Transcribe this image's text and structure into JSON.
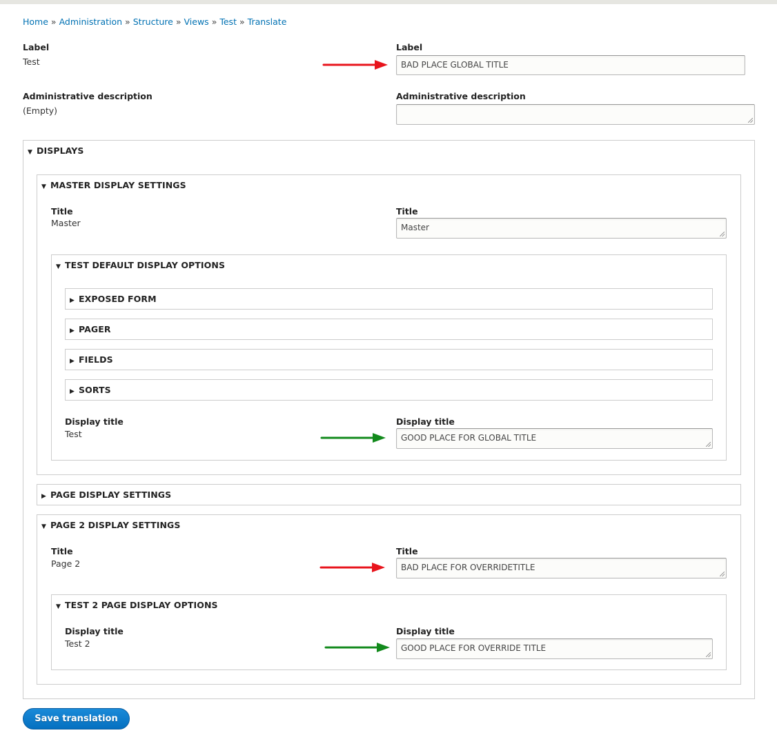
{
  "breadcrumb": [
    "Home",
    "Administration",
    "Structure",
    "Views",
    "Test",
    "Translate"
  ],
  "breadcrumb_sep": "»",
  "label": {
    "left_label": "Label",
    "left_value": "Test",
    "right_label": "Label",
    "input_value": "BAD PLACE GLOBAL TITLE"
  },
  "admin_desc": {
    "left_label": "Administrative description",
    "left_value": "(Empty)",
    "right_label": "Administrative description",
    "input_value": ""
  },
  "displays": {
    "summary": "Displays",
    "master": {
      "summary": "Master display settings",
      "title_label": "Title",
      "title_value": "Master",
      "title_right_label": "Title",
      "title_input": "Master",
      "options": {
        "summary": "Test default display options",
        "collapsed": [
          "Exposed form",
          "Pager",
          "Fields",
          "Sorts"
        ],
        "display_title_label": "Display title",
        "display_title_value": "Test",
        "display_title_right_label": "Display title",
        "display_title_input": "GOOD PLACE FOR GLOBAL TITLE"
      }
    },
    "page": {
      "summary": "Page display settings"
    },
    "page2": {
      "summary": "Page 2 display settings",
      "title_label": "Title",
      "title_value": "Page 2",
      "title_right_label": "Title",
      "title_input": "BAD PLACE FOR OVERRIDETITLE",
      "options": {
        "summary": "Test 2 page display options",
        "display_title_label": "Display title",
        "display_title_value": "Test 2",
        "display_title_right_label": "Display title",
        "display_title_input": "GOOD PLACE FOR OVERRIDE TITLE"
      }
    }
  },
  "save_button": "Save translation",
  "colors": {
    "link": "#0071b3",
    "button": "#0a74c4",
    "red_arrow": "#e8141c",
    "green_arrow": "#128a1c"
  },
  "icons": {
    "expanded": "triangle-down-icon",
    "collapsed": "triangle-right-icon"
  }
}
